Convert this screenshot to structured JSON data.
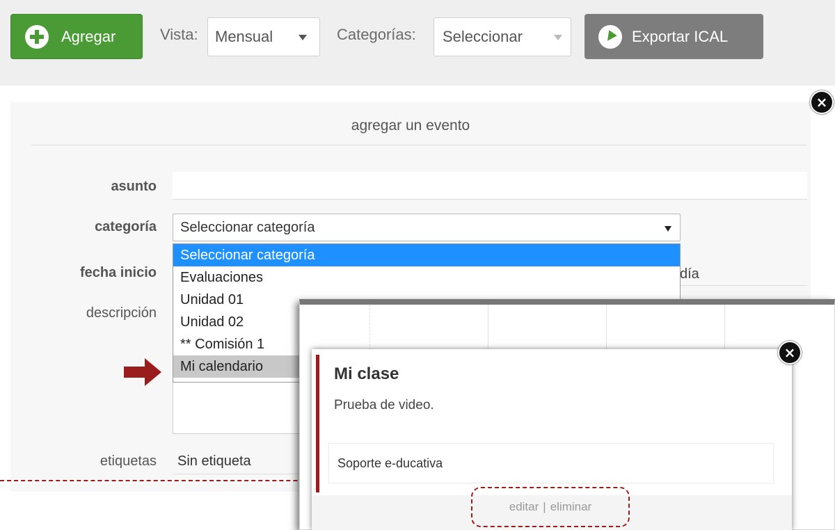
{
  "toolbar": {
    "add_label": "Agregar",
    "view_label": "Vista:",
    "view_value": "Mensual",
    "categories_label": "Categorías:",
    "categories_value": "Seleccionar",
    "export_label": "Exportar ICAL"
  },
  "form": {
    "title": "agregar un evento",
    "subject_label": "asunto",
    "category_label": "categoría",
    "category_value": "Seleccionar categoría",
    "category_options": [
      "Seleccionar categoría",
      "Evaluaciones",
      "Unidad 01",
      "Unidad 02",
      "** Comisión 1",
      "Mi calendario"
    ],
    "start_date_label": "fecha inicio",
    "all_day_text": "día",
    "description_label": "descripción",
    "tags_label": "etiquetas",
    "tags_value": "Sin etiqueta"
  },
  "event_popup": {
    "title": "Mi clase",
    "description": "Prueba de video.",
    "organizer": "Soporte e-ducativa",
    "edit_label": "editar",
    "separator": "|",
    "delete_label": "eliminar"
  },
  "colors": {
    "accent_green": "#4a9a35",
    "export_gray": "#7d7d7d",
    "highlight_blue": "#1e90ff",
    "annotation_red": "#9b1c1c"
  }
}
